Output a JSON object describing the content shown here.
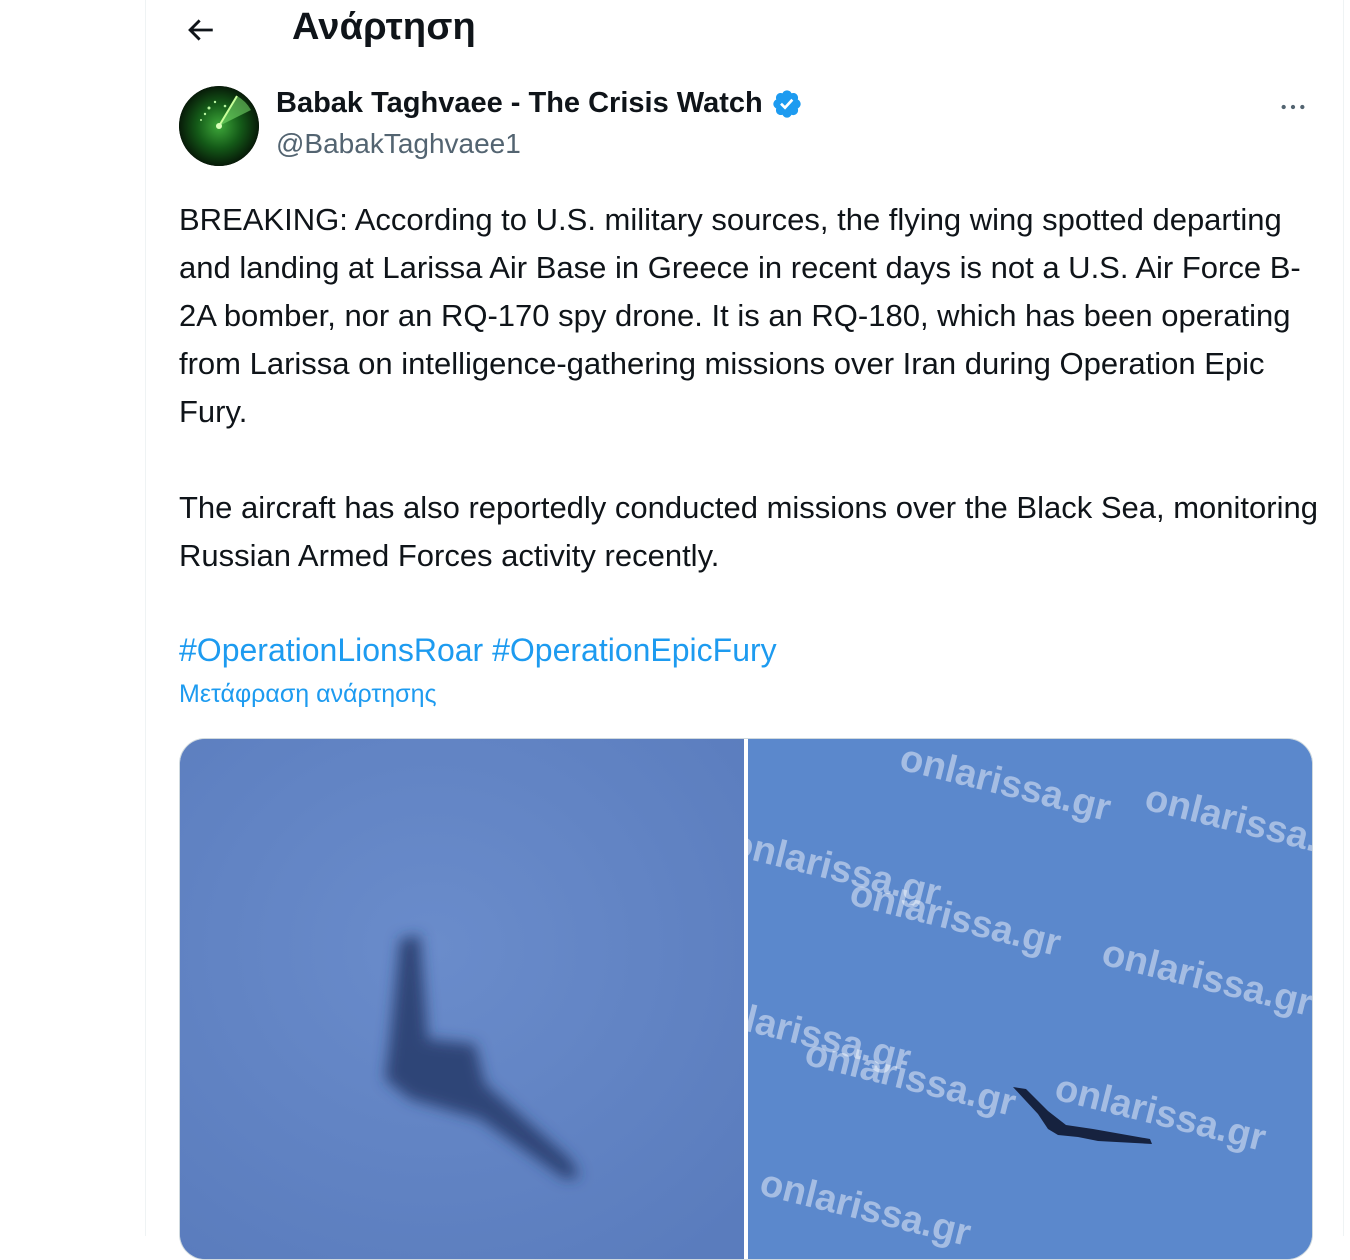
{
  "header": {
    "title": "Ανάρτηση"
  },
  "author": {
    "name": "Babak Taghvaee - The Crisis Watch",
    "handle": "@BabakTaghvaee1"
  },
  "post": {
    "paragraph_1": "BREAKING: According to U.S. military sources, the flying wing spotted departing and landing at Larissa Air Base in Greece in recent days is not a U.S. Air Force B-2A bomber, nor an RQ-170 spy drone. It is an RQ-180, which has been operating from Larissa on intelligence-gathering missions over Iran during Operation Epic Fury.",
    "paragraph_2": "The aircraft has also reportedly conducted missions over the Black Sea, monitoring Russian Armed Forces activity recently.",
    "hashtags": [
      "#OperationLionsRoar",
      "#OperationEpicFury"
    ],
    "translate_label": "Μετάφραση ανάρτησης"
  },
  "media": {
    "watermark_text": "onlarissa.gr",
    "left_bg": "#6284c2",
    "right_bg": "#5b88cc"
  },
  "colors": {
    "accent": "#1d9bf0",
    "text_primary": "#0f1419",
    "text_secondary": "#536471",
    "border": "#cfd9de"
  },
  "icons": {
    "back": "arrow-left-icon",
    "verified": "verified-badge-icon",
    "more": "more-horizontal-icon"
  }
}
